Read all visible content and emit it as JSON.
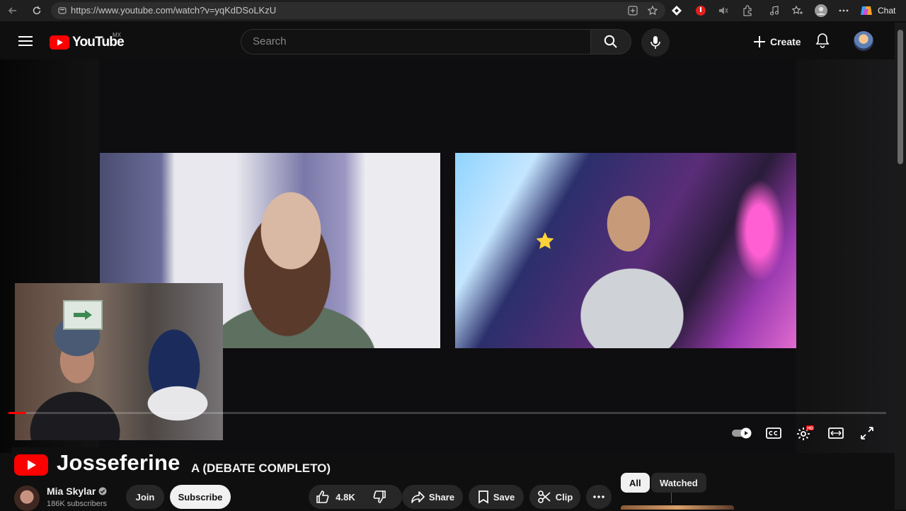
{
  "browser": {
    "url_display": "https://www.youtube.com/watch?v=yqKdDSoLKzU",
    "chat_label": "Chat"
  },
  "masthead": {
    "logo_text": "YouTube",
    "region": "MX",
    "search_placeholder": "Search",
    "create_label": "Create"
  },
  "player": {
    "progress_fraction": 0.02,
    "overlay_channel_name": "Josseferine"
  },
  "video": {
    "title_visible": "A (DEBATE COMPLETO)",
    "channel_name": "Mia Skylar",
    "subscribers": "186K subscribers",
    "join_label": "Join",
    "subscribe_label": "Subscribe",
    "like_count": "4.8K",
    "share_label": "Share",
    "save_label": "Save",
    "clip_label": "Clip"
  },
  "related": {
    "chips": [
      "All",
      "Watched"
    ]
  },
  "colors": {
    "brand_red": "#ff0000",
    "background": "#0f0f0f",
    "pill_bg": "#272727"
  }
}
